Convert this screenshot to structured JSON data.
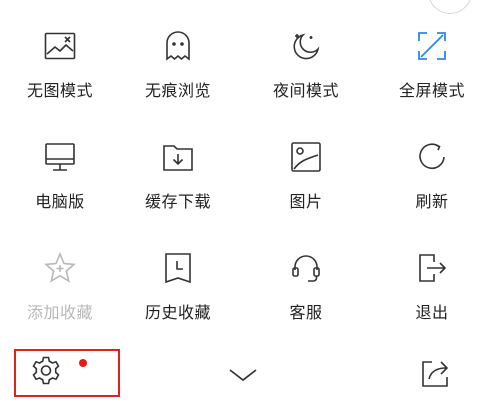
{
  "menu": {
    "items": [
      {
        "label": "无图模式",
        "icon": "no-image-icon"
      },
      {
        "label": "无痕浏览",
        "icon": "ghost-icon"
      },
      {
        "label": "夜间模式",
        "icon": "moon-icon"
      },
      {
        "label": "全屏模式",
        "icon": "fullscreen-icon"
      },
      {
        "label": "电脑版",
        "icon": "desktop-icon"
      },
      {
        "label": "缓存下载",
        "icon": "download-folder-icon"
      },
      {
        "label": "图片",
        "icon": "picture-icon"
      },
      {
        "label": "刷新",
        "icon": "refresh-icon"
      },
      {
        "label": "添加收藏",
        "icon": "star-add-icon"
      },
      {
        "label": "历史收藏",
        "icon": "history-icon"
      },
      {
        "label": "客服",
        "icon": "headset-icon"
      },
      {
        "label": "退出",
        "icon": "exit-icon"
      }
    ]
  },
  "bottom_bar": {
    "settings": {
      "icon": "gear-icon",
      "has_notification_dot": true
    },
    "collapse": {
      "icon": "chevron-down-icon"
    },
    "share": {
      "icon": "share-icon"
    }
  },
  "colors": {
    "icon": "#333333",
    "active_icon": "#2f87e8",
    "disabled": "#b8b8b8",
    "highlight_border": "#e0231a",
    "notification_dot": "#e41a1a"
  }
}
